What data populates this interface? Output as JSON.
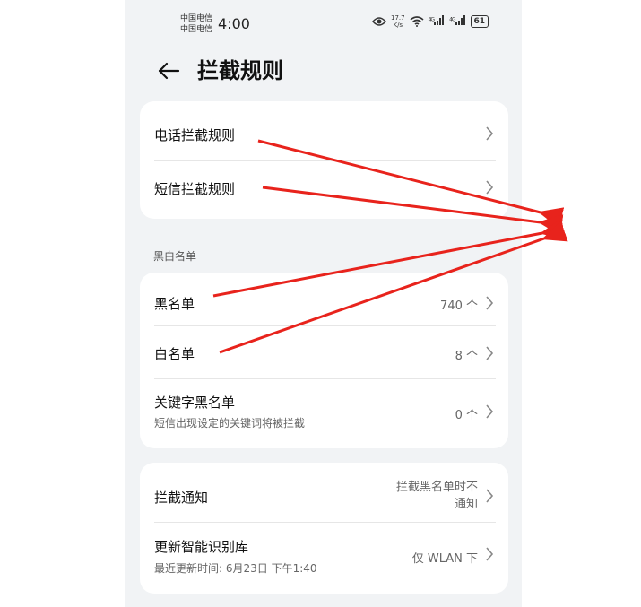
{
  "status_bar": {
    "carrier_1": "中国电信",
    "carrier_2": "中国电信",
    "time": "4:00",
    "speed_value": "17.7",
    "speed_unit": "K/s",
    "network_1": "4G",
    "network_2": "4G",
    "battery": "61"
  },
  "header": {
    "title": "拦截规则"
  },
  "rules_card": {
    "call_rules": "电话拦截规则",
    "sms_rules": "短信拦截规则"
  },
  "lists_section": {
    "heading": "黑白名单",
    "blacklist_label": "黑名单",
    "blacklist_count": "740 个",
    "whitelist_label": "白名单",
    "whitelist_count": "8 个",
    "keyword_label": "关键字黑名单",
    "keyword_sub": "短信出现设定的关键词将被拦截",
    "keyword_count": "0 个"
  },
  "settings_card": {
    "notify_label": "拦截通知",
    "notify_value_line1": "拦截黑名单时不",
    "notify_value_line2": "通知",
    "update_label": "更新智能识别库",
    "update_sub": "最近更新时间: 6月23日 下午1:40",
    "update_value": "仅 WLAN 下"
  },
  "annotation_color": "#e8231c"
}
